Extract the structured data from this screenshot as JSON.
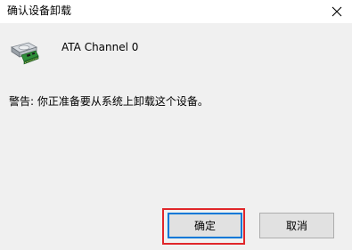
{
  "window": {
    "title": "确认设备卸载",
    "close_glyph": "✕"
  },
  "device": {
    "icon": "ide-controller-icon",
    "name": "ATA Channel 0"
  },
  "warning": {
    "text": "警告: 你正准备要从系统上卸载这个设备。"
  },
  "buttons": {
    "ok_label": "确定",
    "cancel_label": "取消"
  },
  "colors": {
    "focus_border": "#0078d7",
    "highlight": "#e0262a"
  }
}
